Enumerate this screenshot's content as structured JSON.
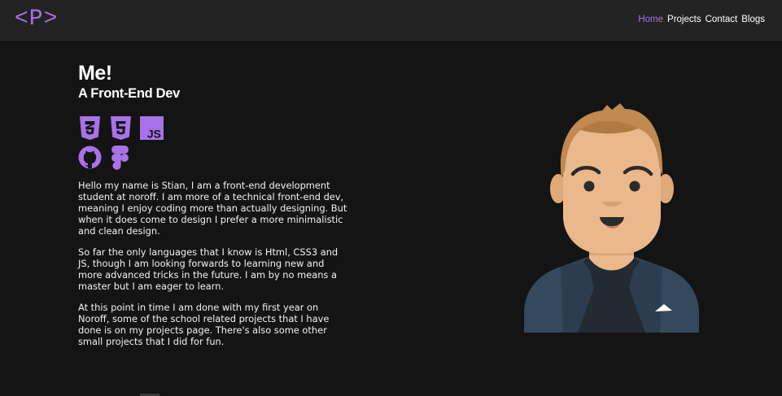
{
  "logo": {
    "text": "<P>"
  },
  "nav": {
    "items": [
      {
        "label": "Home",
        "active": true
      },
      {
        "label": "Projects",
        "active": false
      },
      {
        "label": "Contact",
        "active": false
      },
      {
        "label": "Blogs",
        "active": false
      }
    ]
  },
  "hero": {
    "title": "Me!",
    "subtitle": "A Front-End Dev"
  },
  "skills": {
    "icons": [
      "css3-icon",
      "html5-icon",
      "javascript-icon",
      "github-icon",
      "figma-icon"
    ]
  },
  "bio": {
    "paragraphs": [
      "Hello my name is Stian, I am a front-end development student at noroff. I am more of a technical front-end dev, meaning I enjoy coding more than actually designing. But when it does come to design I prefer a more minimalistic and clean design.",
      "So far the only languages that I know is Html, CSS3 and JS, though I am looking forwards to learning new and more advanced tricks in the future. I am by no means a master but I am eager to learn.",
      "At this point in time I am done with my first year on Noroff, some of the school related projects that I have done is on my projects page. There's also some other small projects that I did for fun."
    ]
  },
  "colors": {
    "background": "#141414",
    "navbar": "#232323",
    "accent": "#a872e8",
    "text": "#ffffff"
  }
}
